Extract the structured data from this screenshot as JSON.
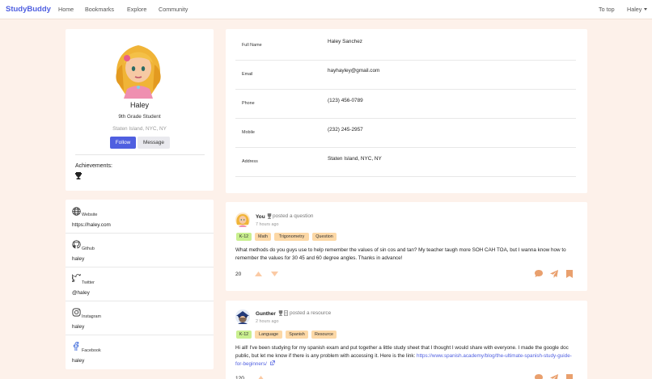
{
  "nav": {
    "brand": "StudyBuddy",
    "links": [
      "Home",
      "Bookmarks",
      "Explore",
      "Community"
    ],
    "to_top": "To top",
    "user": "Haley"
  },
  "profile": {
    "name": "Haley",
    "grade": "9th Grade Student",
    "location": "Staten Island, NYC, NY",
    "follow_label": "Follow",
    "message_label": "Message",
    "achievements_label": "Achievements:",
    "achievement_icon": "trophy-icon"
  },
  "details": [
    {
      "label": "Full Name",
      "value": "Haley Sanchez"
    },
    {
      "label": "Email",
      "value": "hayhayley@gmail.com"
    },
    {
      "label": "Phone",
      "value": "(123) 456-0789"
    },
    {
      "label": "Mobile",
      "value": "(232) 245-2957"
    },
    {
      "label": "Address",
      "value": "Staten Island, NYC, NY"
    }
  ],
  "links": [
    {
      "label": "Website",
      "value": "https://haley.com",
      "icon": "globe-icon"
    },
    {
      "label": "Github",
      "value": "haley",
      "icon": "github-icon"
    },
    {
      "label": "Twitter",
      "value": "@haley",
      "icon": "twitter-icon"
    },
    {
      "label": "Instagram",
      "value": "haley",
      "icon": "instagram-icon"
    },
    {
      "label": "Facebook",
      "value": "haley",
      "icon": "facebook-icon"
    }
  ],
  "posts": [
    {
      "author": "You",
      "action": "posted a question",
      "time": "7 hours ago",
      "tags": [
        "K-12",
        "Math",
        "Trigonometry",
        "Question"
      ],
      "body": "What methods do you guys use to help remember the values of sin cos and tan? My teacher taugh more SOH CAH TOA, but I wanna know how to remember the values for 30 45 and 60 degree angles. Thanks in advance!",
      "score": "20"
    },
    {
      "author": "Gunther",
      "action": "posted a resource",
      "time": "2 hours ago",
      "tags": [
        "K-12",
        "Language",
        "Spanish",
        "Resource"
      ],
      "body": "Hi all! I've been studying for my spanish exam and put together a little study sheet that I thought I would share with everyone. I made the google doc public, but let me know if there is any problem with accessing it. Here is the link:",
      "link": "https://www.spanish.academy/blog/the-ultimate-spanish-study-guide-for-beginners/",
      "score": "120"
    }
  ],
  "colors": {
    "accent": "#4f5fe0",
    "background": "#fdf1ea",
    "tag_green": "#c9ef8f",
    "tag_orange": "#fcd8a6",
    "action_icon": "#e9a06e"
  }
}
